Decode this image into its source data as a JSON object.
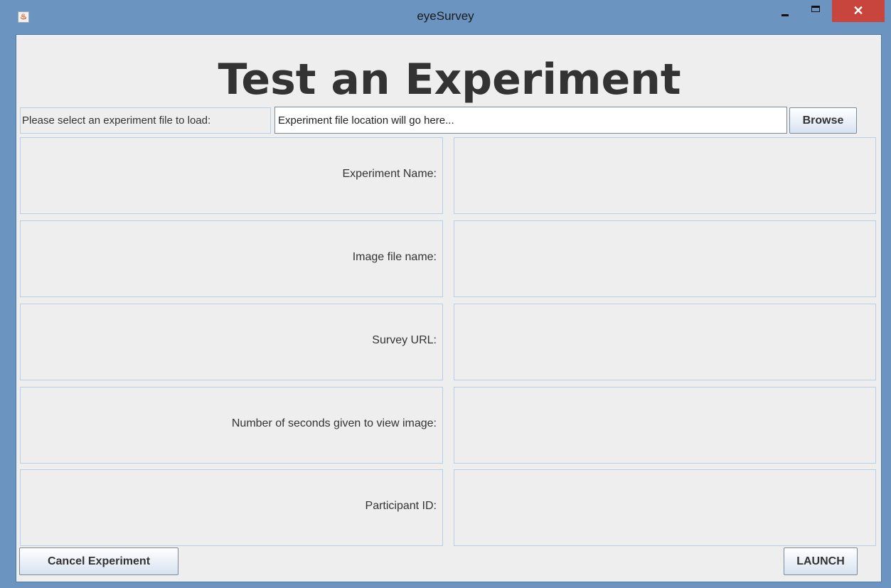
{
  "window": {
    "title": "eyeSurvey",
    "close_glyph": "✕",
    "app_icon_glyph": "♨"
  },
  "heading": "Test an Experiment",
  "file_selector": {
    "label": "Please select an experiment file to load:",
    "value": "Experiment file location will go here...",
    "browse_label": "Browse"
  },
  "fields": [
    {
      "label": "Experiment Name:",
      "value": ""
    },
    {
      "label": "Image file name:",
      "value": ""
    },
    {
      "label": "Survey URL:",
      "value": ""
    },
    {
      "label": "Number of seconds given to view image:",
      "value": ""
    },
    {
      "label": "Participant ID:",
      "value": ""
    }
  ],
  "footer": {
    "cancel_label": "Cancel Experiment",
    "launch_label": "LAUNCH"
  },
  "colors": {
    "frame": "#6b95c0",
    "client_bg": "#eeeeee",
    "close_button": "#c7453c",
    "cell_border": "#b8cfe5"
  }
}
